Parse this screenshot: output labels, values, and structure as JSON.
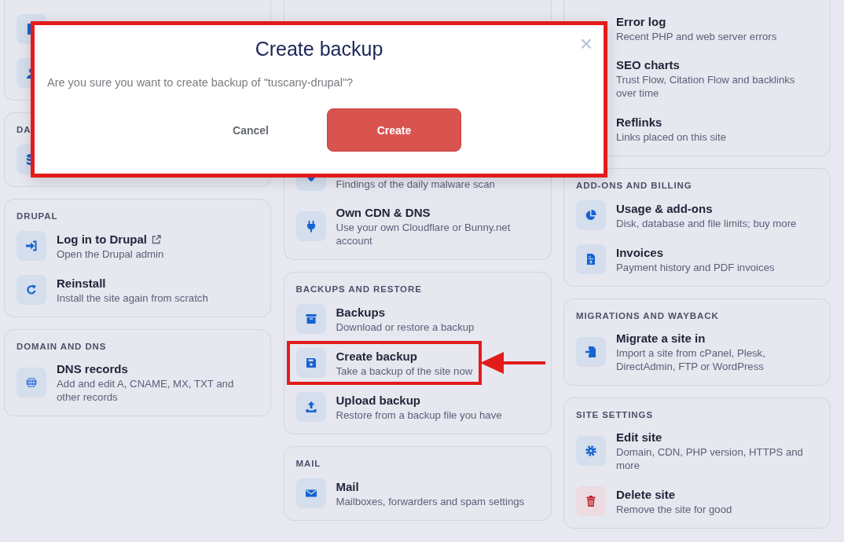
{
  "columns": [
    [
      {
        "items": [
          {
            "kind": "icon-only"
          },
          {
            "kind": "icon-only"
          }
        ]
      },
      {
        "heading": "DA",
        "items": [
          {
            "kind": "icon-only"
          }
        ]
      },
      {
        "heading": "DRUPAL",
        "items": [
          {
            "title": "Log in to Drupal",
            "external": true,
            "description": "Open the Drupal admin"
          },
          {
            "title": "Reinstall",
            "description": "Install the site again from scratch"
          }
        ]
      },
      {
        "heading": "DOMAIN AND DNS",
        "items": [
          {
            "title": "DNS records",
            "description": "Add and edit A, CNAME, MX, TXT and other records"
          }
        ]
      }
    ],
    [
      {
        "items": [
          {
            "description": "Findings of the daily malware scan"
          },
          {
            "title": "Own CDN & DNS",
            "description": "Use your own Cloudflare or Bunny.net account"
          }
        ]
      },
      {
        "heading": "BACKUPS AND RESTORE",
        "items": [
          {
            "title": "Backups",
            "description": "Download or restore a backup",
            "highlighted": false
          },
          {
            "title": "Create backup",
            "description": "Take a backup of the site now",
            "highlighted": true
          },
          {
            "title": "Upload backup",
            "description": "Restore from a backup file you have",
            "highlighted": false
          }
        ]
      },
      {
        "heading": "MAIL",
        "items": [
          {
            "title": "Mail",
            "description": "Mailboxes, forwarders and spam settings"
          }
        ]
      }
    ],
    [
      {
        "items": [
          {
            "title": "Error log",
            "description": "Recent PHP and web server errors"
          },
          {
            "title": "SEO charts",
            "description": "Trust Flow, Citation Flow and backlinks over time"
          },
          {
            "title": "Reflinks",
            "description": "Links placed on this site"
          }
        ]
      },
      {
        "heading": "ADD-ONS AND BILLING",
        "items": [
          {
            "title": "Usage & add-ons",
            "description": "Disk, database and file limits; buy more"
          },
          {
            "title": "Invoices",
            "description": "Payment history and PDF invoices"
          }
        ]
      },
      {
        "heading": "MIGRATIONS AND WAYBACK",
        "items": [
          {
            "title": "Migrate a site in",
            "description": "Import a site from cPanel, Plesk, DirectAdmin, FTP or WordPress"
          }
        ]
      },
      {
        "heading": "SITE SETTINGS",
        "items": [
          {
            "title": "Edit site",
            "description": "Domain, CDN, PHP version, HTTPS and more",
            "danger": false
          },
          {
            "title": "Delete site",
            "description": "Remove the site for good",
            "danger": true
          }
        ]
      }
    ]
  ],
  "dialog": {
    "title": "Create backup",
    "close": "×",
    "message": "Are you sure you want to create backup of \"tuscany-drupal\"?",
    "buttons": [
      {
        "label": "Cancel",
        "kind": "secondary"
      },
      {
        "label": "Create",
        "kind": "primary"
      }
    ]
  }
}
